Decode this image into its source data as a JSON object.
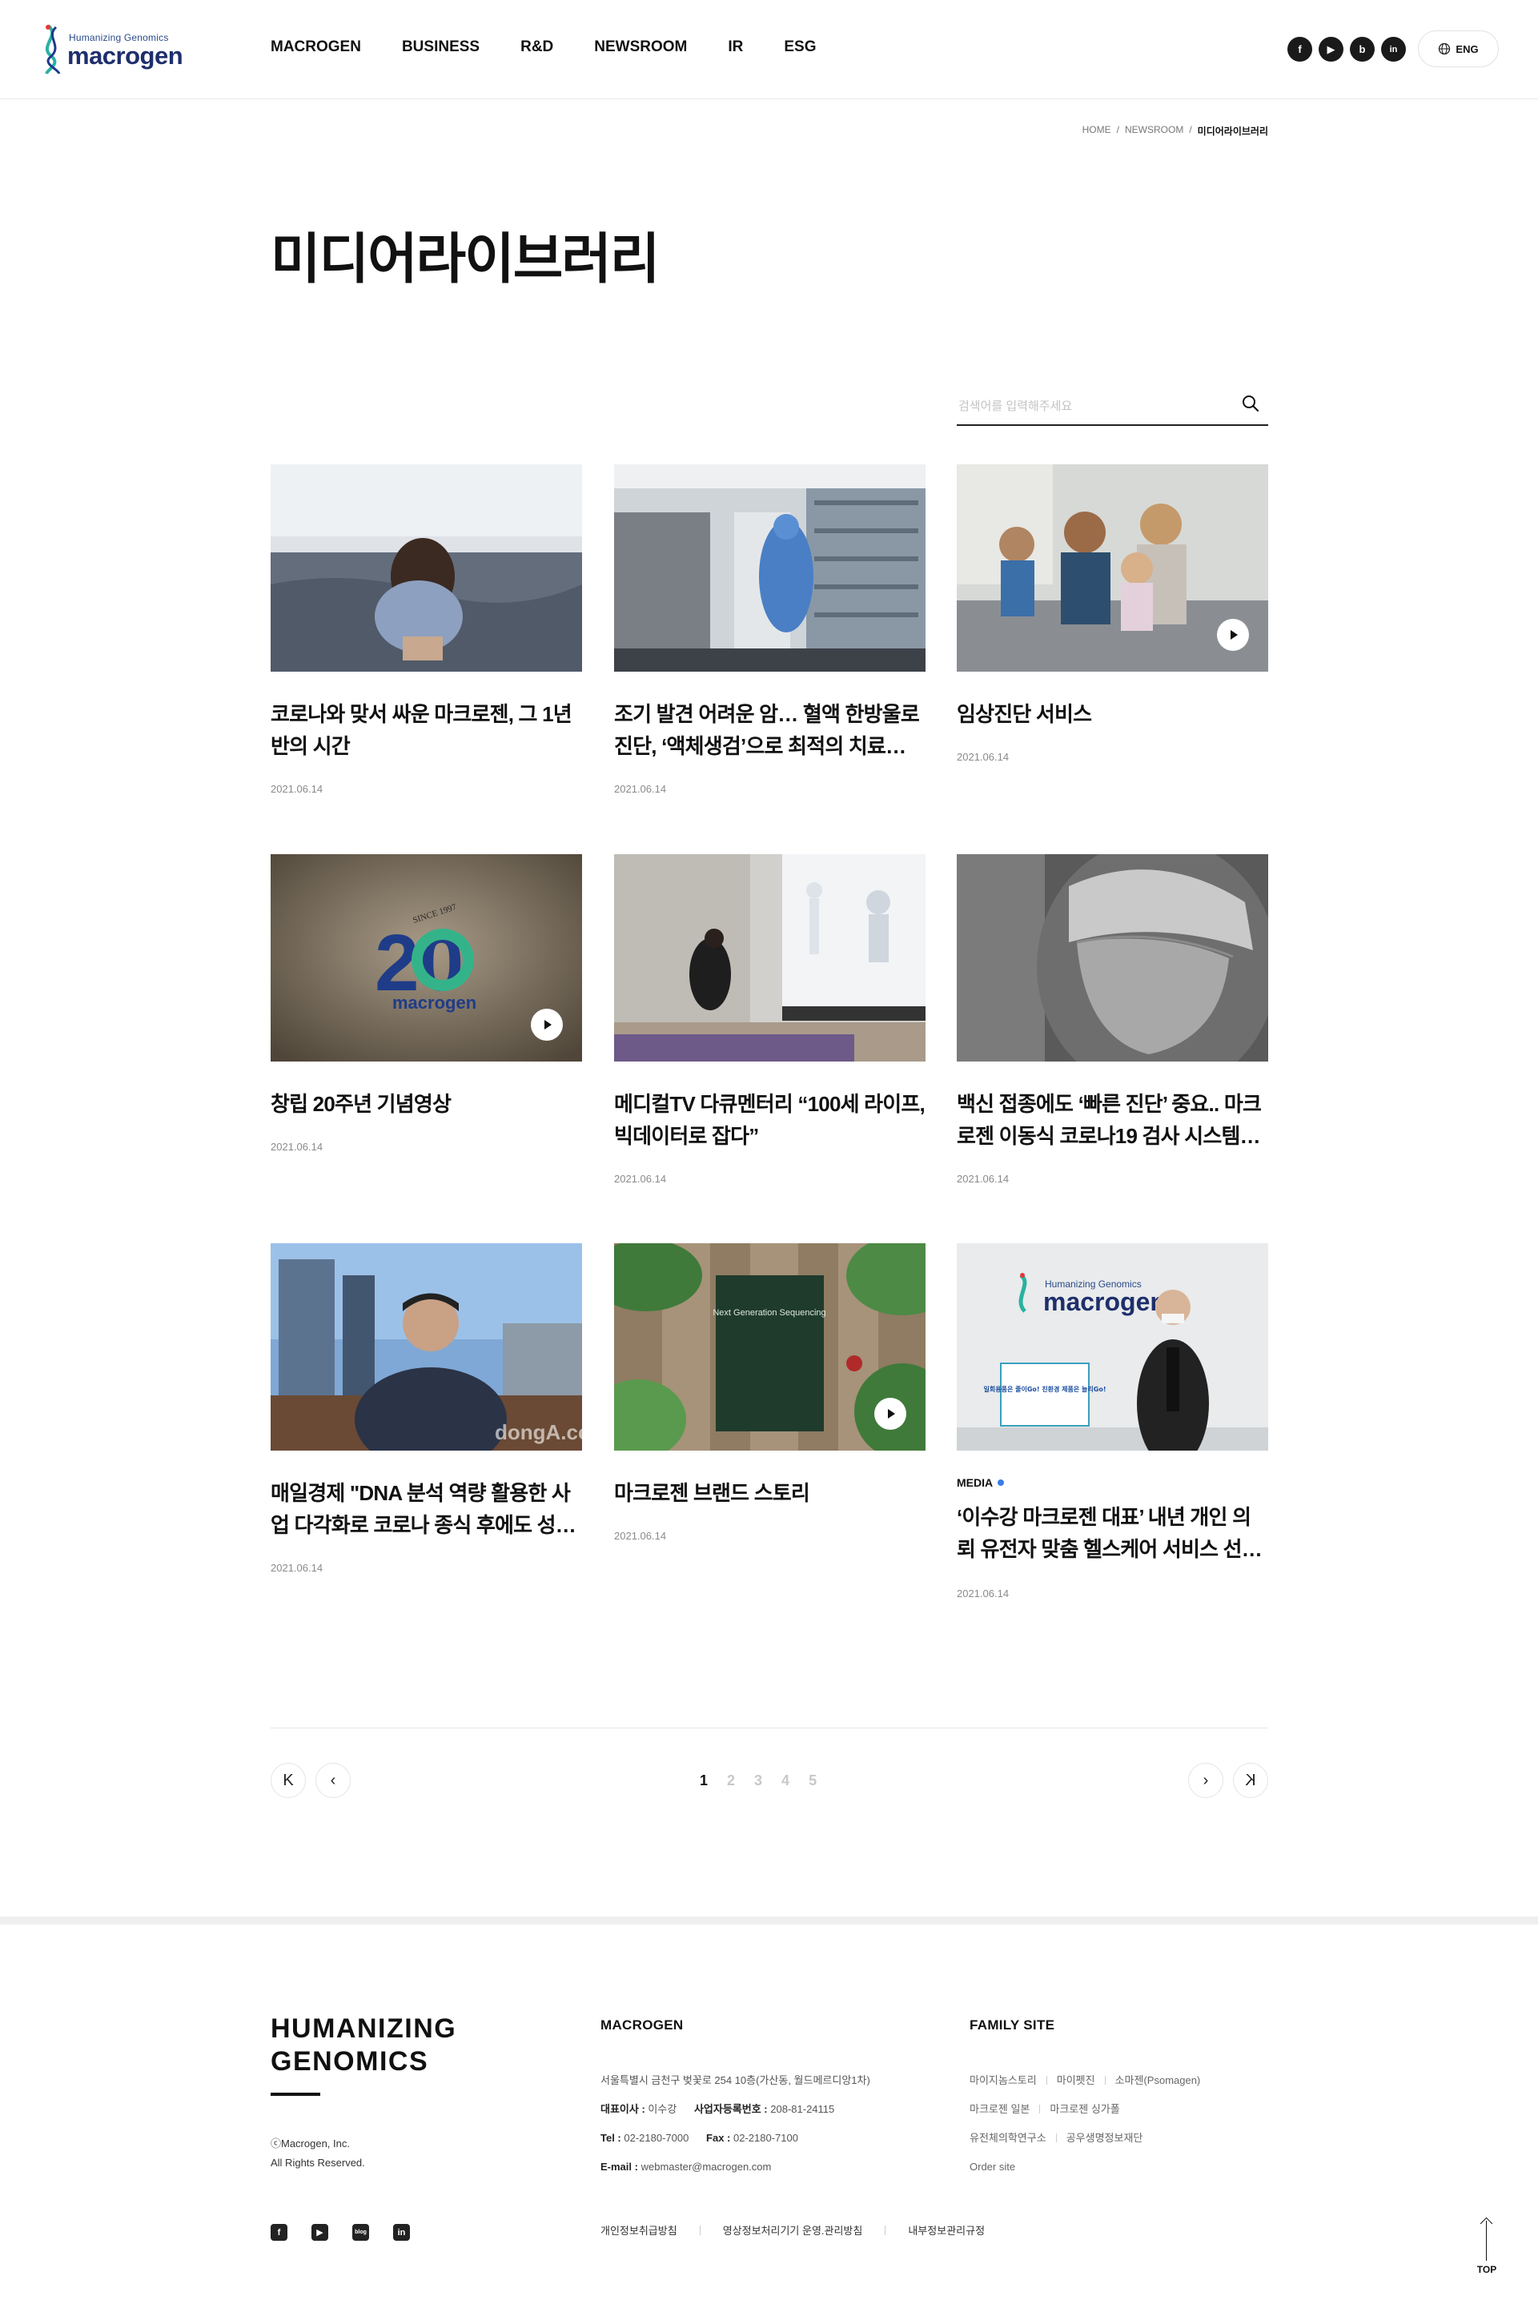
{
  "header": {
    "logo_tagline": "Humanizing Genomics",
    "logo_word": "macrogen",
    "nav": [
      "MACROGEN",
      "BUSINESS",
      "R&D",
      "NEWSROOM",
      "IR",
      "ESG"
    ],
    "sns_icons": [
      "facebook-icon",
      "youtube-icon",
      "blog-icon",
      "linkedin-icon"
    ],
    "sns_glyphs": [
      "f",
      "▶",
      "b",
      "in"
    ],
    "lang_label": "ENG"
  },
  "breadcrumb": [
    "HOME",
    "/",
    "NEWSROOM",
    "/",
    "미디어라이브러리"
  ],
  "page_title": "미디어라이브러리",
  "search": {
    "placeholder": "검색어를 입력해주세요"
  },
  "cards": [
    {
      "category": "",
      "title": "코로나와 맞서 싸운 마크로젠, 그 1년 반의 시간",
      "date": "2021.06.14",
      "video": false
    },
    {
      "category": "",
      "title": "조기 발견 어려운 암… 혈액 한방울로 진단, ‘액체생검’으로 최적의 치료…",
      "date": "2021.06.14",
      "video": false
    },
    {
      "category": "",
      "title": "임상진단 서비스",
      "date": "2021.06.14",
      "video": true
    },
    {
      "category": "",
      "title": "창립 20주년 기념영상",
      "date": "2021.06.14",
      "video": true
    },
    {
      "category": "",
      "title": "메디컬TV 다큐멘터리 “100세 라이프, 빅데이터로 잡다”",
      "date": "2021.06.14",
      "video": false
    },
    {
      "category": "",
      "title": "백신 접종에도 ‘빠른 진단’ 중요.. 마크로젠 이동식 코로나19 검사 시스템…",
      "date": "2021.06.14",
      "video": false
    },
    {
      "category": "",
      "title": "매일경제 \"DNA 분석 역량 활용한 사업 다각화로 코로나 종식 후에도 성…",
      "date": "2021.06.14",
      "video": false
    },
    {
      "category": "",
      "title": "마크로젠 브랜드 스토리",
      "date": "2021.06.14",
      "video": true
    },
    {
      "category": "MEDIA",
      "title": "‘이수강 마크로젠 대표’ 내년 개인 의뢰 유전자 맞춤 헬스케어 서비스 선…",
      "date": "2021.06.14",
      "video": false
    }
  ],
  "thumb_text": {
    "since": "SINCE 1997",
    "twenty": "20",
    "book": "Next Generation Sequencing",
    "watermark": "dongA.com",
    "banner": "일회용품은 줄이Go! 친환경 제품은 늘리Go!"
  },
  "pagination": {
    "pages": [
      "1",
      "2",
      "3",
      "4",
      "5"
    ],
    "current": "1",
    "first": "K",
    "prev": "‹",
    "next": "›",
    "last": "K"
  },
  "footer": {
    "brand_line1": "HUMANIZING",
    "brand_line2": "GENOMICS",
    "copyright": "ⓒMacrogen, Inc.",
    "rights": "All Rights Reserved.",
    "company_head": "MACROGEN",
    "address": "서울특별시 금천구 벚꽃로 254 10층(가산동, 월드메르디앙1차)",
    "ceo_label": "대표이사 :",
    "ceo": "이수강",
    "bizno_label": "사업자등록번호 :",
    "bizno": "208-81-24115",
    "tel_label": "Tel :",
    "tel": "02-2180-7000",
    "fax_label": "Fax :",
    "fax": "02-2180-7100",
    "email_label": "E-mail :",
    "email": "webmaster@macrogen.com",
    "family_head": "FAMILY SITE",
    "family": [
      [
        "마이지놈스토리",
        "마이펫진",
        "소마젠(Psomagen)"
      ],
      [
        "마크로젠 일본",
        "마크로젠 싱가폴"
      ],
      [
        "유전체의학연구소",
        "공우생명정보재단"
      ],
      [
        "Order site"
      ]
    ],
    "policies": [
      "개인정보취급방침",
      "영상정보처리기기 운영.관리방침",
      "내부정보관리규정"
    ],
    "sns_glyphs": [
      "f",
      "▶",
      "blog",
      "in"
    ],
    "top_label": "TOP"
  }
}
